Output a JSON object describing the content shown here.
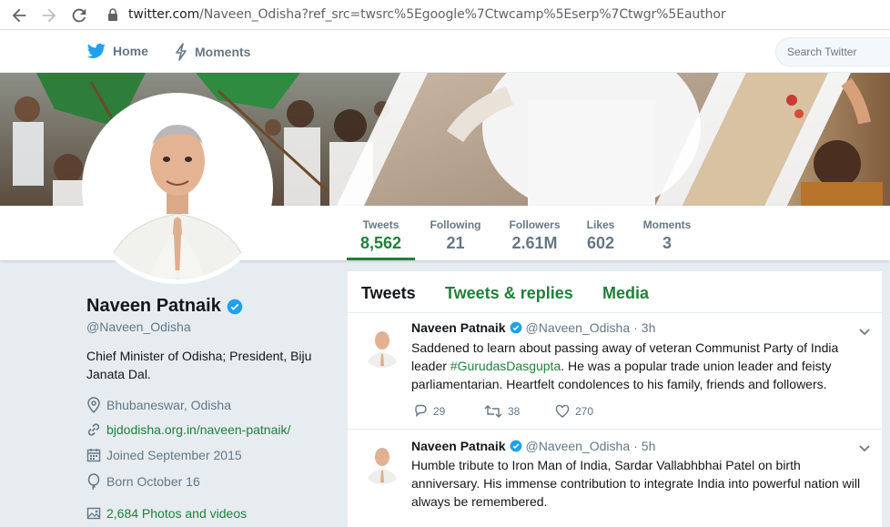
{
  "browser": {
    "url_host": "twitter.com",
    "url_path": "/Naveen_Odisha?ref_src=twsrc%5Egoogle%7Ctwcamp%5Eserp%7Ctwgr%5Eauthor",
    "icons": [
      "back-arrow-icon",
      "forward-arrow-icon",
      "reload-icon",
      "lock-icon"
    ]
  },
  "topnav": {
    "home": "Home",
    "moments": "Moments",
    "search_placeholder": "Search Twitter"
  },
  "stats": [
    {
      "label": "Tweets",
      "value": "8,562",
      "active": true
    },
    {
      "label": "Following",
      "value": "21",
      "active": false
    },
    {
      "label": "Followers",
      "value": "2.61M",
      "active": false
    },
    {
      "label": "Likes",
      "value": "602",
      "active": false
    },
    {
      "label": "Moments",
      "value": "3",
      "active": false
    }
  ],
  "profile": {
    "name": "Naveen Patnaik",
    "handle": "@Naveen_Odisha",
    "bio": "Chief Minister of Odisha; President, Biju Janata Dal.",
    "location": "Bhubaneswar, Odisha",
    "website": "bjdodisha.org.in/naveen-patnaik/",
    "joined": "Joined September 2015",
    "born": "Born October 16",
    "photos": "2,684 Photos and videos"
  },
  "tabs": {
    "tweets": "Tweets",
    "replies": "Tweets & replies",
    "media": "Media"
  },
  "tweets": [
    {
      "name": "Naveen Patnaik",
      "handle": "@Naveen_Odisha",
      "sep": "·",
      "time": "3h",
      "text_before": "Saddened to learn about passing away of veteran Communist Party of India leader ",
      "hashtag": "#GurudasDasgupta",
      "text_after": ". He was a popular trade union leader and feisty parliamentarian. Heartfelt condolences to his family, friends and followers.",
      "replies": "29",
      "retweets": "38",
      "likes": "270"
    },
    {
      "name": "Naveen Patnaik",
      "handle": "@Naveen_Odisha",
      "sep": "·",
      "time": "5h",
      "text": "Humble tribute to Iron Man of India, Sardar Vallabhbhai Patel on birth anniversary. His immense contribution to integrate India into powerful nation will always be remembered."
    }
  ],
  "colors": {
    "accent": "#20803a",
    "verified": "#1da1f2",
    "muted": "#657786",
    "background": "#e6ecf0"
  }
}
